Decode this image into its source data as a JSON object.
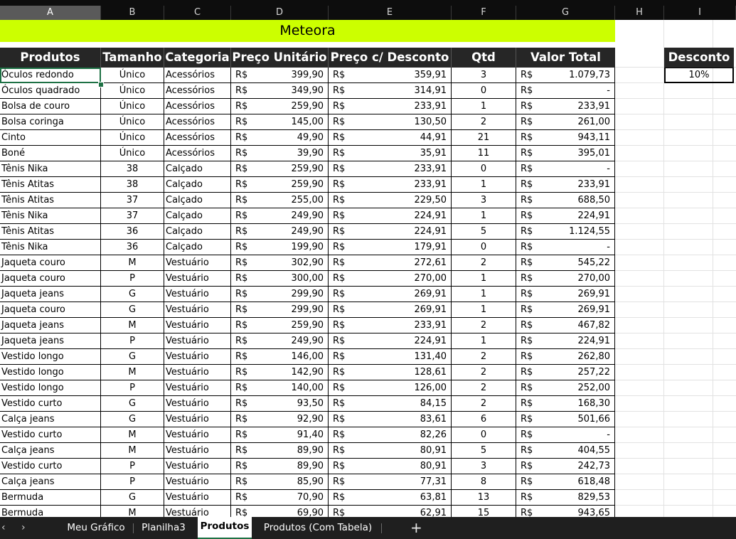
{
  "columns": [
    "A",
    "B",
    "C",
    "D",
    "E",
    "F",
    "G",
    "H",
    "I"
  ],
  "banner": "Meteora",
  "headers": [
    "Produtos",
    "Tamanho",
    "Categoria",
    "Preço Unitário",
    "Preço c/ Desconto",
    "Qtd",
    "Valor Total"
  ],
  "discount": {
    "label": "Desconto",
    "value": "10%"
  },
  "currency": "R$",
  "rows": [
    {
      "produto": "Óculos redondo",
      "tamanho": "Único",
      "categoria": "Acessórios",
      "preco": "399,90",
      "preco_desc": "359,91",
      "qtd": "3",
      "total": "1.079,73"
    },
    {
      "produto": "Óculos quadrado",
      "tamanho": "Único",
      "categoria": "Acessórios",
      "preco": "349,90",
      "preco_desc": "314,91",
      "qtd": "0",
      "total": "-"
    },
    {
      "produto": "Bolsa de couro",
      "tamanho": "Único",
      "categoria": "Acessórios",
      "preco": "259,90",
      "preco_desc": "233,91",
      "qtd": "1",
      "total": "233,91"
    },
    {
      "produto": "Bolsa coringa",
      "tamanho": "Único",
      "categoria": "Acessórios",
      "preco": "145,00",
      "preco_desc": "130,50",
      "qtd": "2",
      "total": "261,00"
    },
    {
      "produto": "Cinto",
      "tamanho": "Único",
      "categoria": "Acessórios",
      "preco": "49,90",
      "preco_desc": "44,91",
      "qtd": "21",
      "total": "943,11"
    },
    {
      "produto": "Boné",
      "tamanho": "Único",
      "categoria": "Acessórios",
      "preco": "39,90",
      "preco_desc": "35,91",
      "qtd": "11",
      "total": "395,01"
    },
    {
      "produto": "Tênis Nika",
      "tamanho": "38",
      "categoria": "Calçado",
      "preco": "259,90",
      "preco_desc": "233,91",
      "qtd": "0",
      "total": "-"
    },
    {
      "produto": "Tênis Atitas",
      "tamanho": "38",
      "categoria": "Calçado",
      "preco": "259,90",
      "preco_desc": "233,91",
      "qtd": "1",
      "total": "233,91"
    },
    {
      "produto": "Tênis Atitas",
      "tamanho": "37",
      "categoria": "Calçado",
      "preco": "255,00",
      "preco_desc": "229,50",
      "qtd": "3",
      "total": "688,50"
    },
    {
      "produto": "Tênis Nika",
      "tamanho": "37",
      "categoria": "Calçado",
      "preco": "249,90",
      "preco_desc": "224,91",
      "qtd": "1",
      "total": "224,91"
    },
    {
      "produto": "Tênis Atitas",
      "tamanho": "36",
      "categoria": "Calçado",
      "preco": "249,90",
      "preco_desc": "224,91",
      "qtd": "5",
      "total": "1.124,55"
    },
    {
      "produto": "Tênis Nika",
      "tamanho": "36",
      "categoria": "Calçado",
      "preco": "199,90",
      "preco_desc": "179,91",
      "qtd": "0",
      "total": "-"
    },
    {
      "produto": "Jaqueta couro",
      "tamanho": "M",
      "categoria": "Vestuário",
      "preco": "302,90",
      "preco_desc": "272,61",
      "qtd": "2",
      "total": "545,22"
    },
    {
      "produto": "Jaqueta couro",
      "tamanho": "P",
      "categoria": "Vestuário",
      "preco": "300,00",
      "preco_desc": "270,00",
      "qtd": "1",
      "total": "270,00"
    },
    {
      "produto": "Jaqueta jeans",
      "tamanho": "G",
      "categoria": "Vestuário",
      "preco": "299,90",
      "preco_desc": "269,91",
      "qtd": "1",
      "total": "269,91"
    },
    {
      "produto": "Jaqueta couro",
      "tamanho": "G",
      "categoria": "Vestuário",
      "preco": "299,90",
      "preco_desc": "269,91",
      "qtd": "1",
      "total": "269,91"
    },
    {
      "produto": "Jaqueta jeans",
      "tamanho": "M",
      "categoria": "Vestuário",
      "preco": "259,90",
      "preco_desc": "233,91",
      "qtd": "2",
      "total": "467,82"
    },
    {
      "produto": "Jaqueta jeans",
      "tamanho": "P",
      "categoria": "Vestuário",
      "preco": "249,90",
      "preco_desc": "224,91",
      "qtd": "1",
      "total": "224,91"
    },
    {
      "produto": "Vestido longo",
      "tamanho": "G",
      "categoria": "Vestuário",
      "preco": "146,00",
      "preco_desc": "131,40",
      "qtd": "2",
      "total": "262,80"
    },
    {
      "produto": "Vestido longo",
      "tamanho": "M",
      "categoria": "Vestuário",
      "preco": "142,90",
      "preco_desc": "128,61",
      "qtd": "2",
      "total": "257,22"
    },
    {
      "produto": "Vestido longo",
      "tamanho": "P",
      "categoria": "Vestuário",
      "preco": "140,00",
      "preco_desc": "126,00",
      "qtd": "2",
      "total": "252,00"
    },
    {
      "produto": "Vestido curto",
      "tamanho": "G",
      "categoria": "Vestuário",
      "preco": "93,50",
      "preco_desc": "84,15",
      "qtd": "2",
      "total": "168,30"
    },
    {
      "produto": "Calça jeans",
      "tamanho": "G",
      "categoria": "Vestuário",
      "preco": "92,90",
      "preco_desc": "83,61",
      "qtd": "6",
      "total": "501,66"
    },
    {
      "produto": "Vestido curto",
      "tamanho": "M",
      "categoria": "Vestuário",
      "preco": "91,40",
      "preco_desc": "82,26",
      "qtd": "0",
      "total": "-"
    },
    {
      "produto": "Calça jeans",
      "tamanho": "M",
      "categoria": "Vestuário",
      "preco": "89,90",
      "preco_desc": "80,91",
      "qtd": "5",
      "total": "404,55"
    },
    {
      "produto": "Vestido curto",
      "tamanho": "P",
      "categoria": "Vestuário",
      "preco": "89,90",
      "preco_desc": "80,91",
      "qtd": "3",
      "total": "242,73"
    },
    {
      "produto": "Calça jeans",
      "tamanho": "P",
      "categoria": "Vestuário",
      "preco": "85,90",
      "preco_desc": "77,31",
      "qtd": "8",
      "total": "618,48"
    },
    {
      "produto": "Bermuda",
      "tamanho": "G",
      "categoria": "Vestuário",
      "preco": "70,90",
      "preco_desc": "63,81",
      "qtd": "13",
      "total": "829,53"
    },
    {
      "produto": "Bermuda",
      "tamanho": "M",
      "categoria": "Vestuário",
      "preco": "69,90",
      "preco_desc": "62,91",
      "qtd": "15",
      "total": "943,65"
    }
  ],
  "tabs": [
    {
      "label": "Meu Gráfico",
      "active": false
    },
    {
      "label": "Planilha3",
      "active": false
    },
    {
      "label": "Produtos",
      "active": true
    },
    {
      "label": "Produtos (Com Tabela)",
      "active": false
    }
  ],
  "nav": {
    "prev": "‹",
    "next": "›",
    "add": "+"
  },
  "colors": {
    "banner": "#ccff00",
    "header_bg": "#262626",
    "tab_accent": "#1e7145"
  }
}
